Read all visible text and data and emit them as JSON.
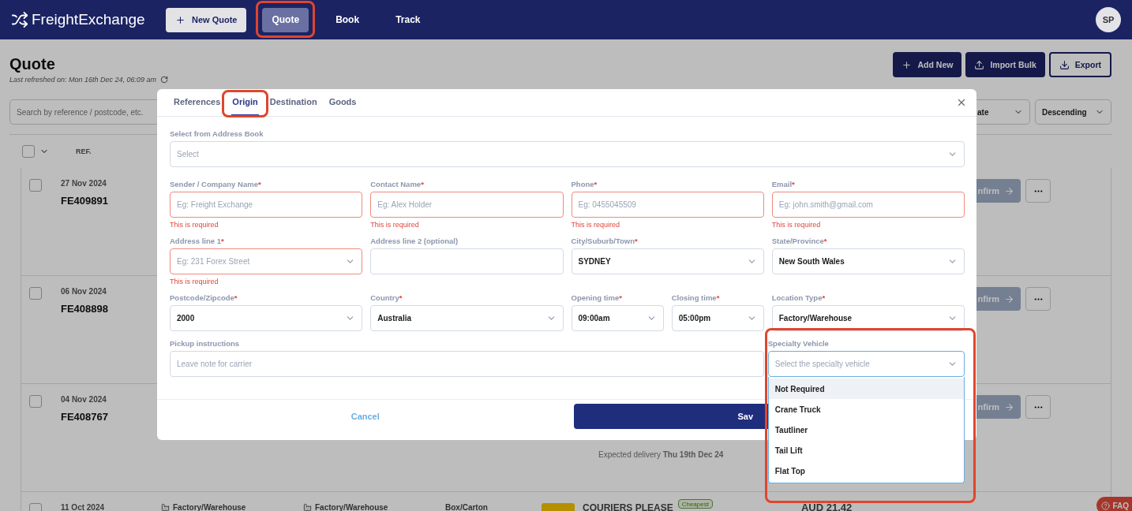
{
  "header": {
    "logo": "FreightExchange",
    "new_quote": "New Quote",
    "avatar": "SP",
    "nav": [
      {
        "label": "Quote",
        "selected": true,
        "highlighted": true
      },
      {
        "label": "Book",
        "selected": false,
        "highlighted": false
      },
      {
        "label": "Track",
        "selected": false,
        "highlighted": false
      }
    ]
  },
  "page": {
    "title": "Quote",
    "refreshed": "Last refreshed on: Mon 16th Dec 24, 06:09 am",
    "actions": [
      {
        "label": "Add New",
        "kind": "add"
      },
      {
        "label": "Import Bulk",
        "kind": "import"
      },
      {
        "label": "Export",
        "kind": "export"
      }
    ],
    "search": {
      "placeholder": "Search by reference / postcode, etc."
    },
    "sort_field": "ate",
    "sort_order": "Descending",
    "column_ref": "REF.",
    "select_all_checked": false,
    "rows": [
      {
        "checked": false,
        "date": "27 Nov 2024",
        "ref": "FE409891",
        "confirm": "nfirm"
      },
      {
        "checked": false,
        "date": "06 Nov 2024",
        "ref": "FE408898",
        "confirm": "nfirm"
      },
      {
        "checked": false,
        "date": "04 Nov 2024",
        "ref": "FE408767",
        "confirm": "nfirm",
        "delivery": "Expected delivery **Thu 19th Dec 24**"
      }
    ],
    "last_row": {
      "checked": false,
      "date": "11 Oct 2024",
      "origin": "Factory/Warehouse",
      "destination": "Factory/Warehouse",
      "goods": "Box/Carton",
      "carrier": "COURIERS PLEASE",
      "badge": "Cheapest",
      "price": "AUD 21.42"
    },
    "faq": "FAQ"
  },
  "modal": {
    "tabs": [
      {
        "label": "References",
        "selected": false,
        "highlighted": false
      },
      {
        "label": "Origin",
        "selected": true,
        "highlighted": true
      },
      {
        "label": "Destination",
        "selected": false,
        "highlighted": false
      },
      {
        "label": "Goods",
        "selected": false,
        "highlighted": false
      }
    ],
    "address_book": {
      "label": "Select from Address Book",
      "placeholder": "Select"
    },
    "fields": [
      {
        "kind": "text",
        "label": "Sender / Company Name",
        "required_mark": "*",
        "placeholder": "Eg: Freight Exchange",
        "error": "This is required"
      },
      {
        "kind": "text",
        "label": "Contact Name",
        "required_mark": "*",
        "placeholder": "Eg: Alex Holder",
        "error": "This is required"
      },
      {
        "kind": "text",
        "label": "Phone",
        "required_mark": "*",
        "placeholder": "Eg: 0455045509",
        "error": "This is required"
      },
      {
        "kind": "text",
        "label": "Email",
        "required_mark": "*",
        "placeholder": "Eg: john.smith@gmail.com",
        "error": "This is required"
      },
      {
        "kind": "select",
        "label": "Address line 1",
        "required_mark": "*",
        "placeholder": "Eg: 231 Forex Street",
        "error": "This is required"
      },
      {
        "kind": "text",
        "label": "Address line 2 (optional)"
      },
      {
        "kind": "select",
        "label": "City/Suburb/Town",
        "required_mark": "*",
        "value": "SYDNEY"
      },
      {
        "kind": "select",
        "label": "State/Province",
        "required_mark": "*",
        "value": "New South Wales"
      },
      {
        "kind": "select",
        "label": "Postcode/Zipcode",
        "required_mark": "*",
        "value": "2000"
      },
      {
        "kind": "select",
        "label": "Country",
        "required_mark": "*",
        "value": "Australia"
      },
      {
        "kind": "time",
        "label": "Opening time",
        "required_mark": "*",
        "value": "09:00am"
      },
      {
        "kind": "time",
        "label": "Closing time",
        "required_mark": "*",
        "value": "05:00pm"
      },
      {
        "kind": "select",
        "label": "Location Type",
        "required_mark": "*",
        "value": "Factory/Warehouse"
      },
      {
        "kind": "note",
        "label": "Pickup instructions",
        "placeholder": "Leave note for carrier"
      },
      {
        "kind": "combo",
        "label": "Specialty Vehicle",
        "placeholder": "Select the specialty vehicle",
        "expanded": true,
        "highlighted": true,
        "options": [
          {
            "label": "Not Required",
            "selected": true
          },
          {
            "label": "Crane Truck",
            "selected": false
          },
          {
            "label": "Tautliner",
            "selected": false
          },
          {
            "label": "Tail Lift",
            "selected": false
          },
          {
            "label": "Flat Top",
            "selected": false
          }
        ]
      }
    ],
    "cancel": "Cancel",
    "save": "Sav"
  }
}
